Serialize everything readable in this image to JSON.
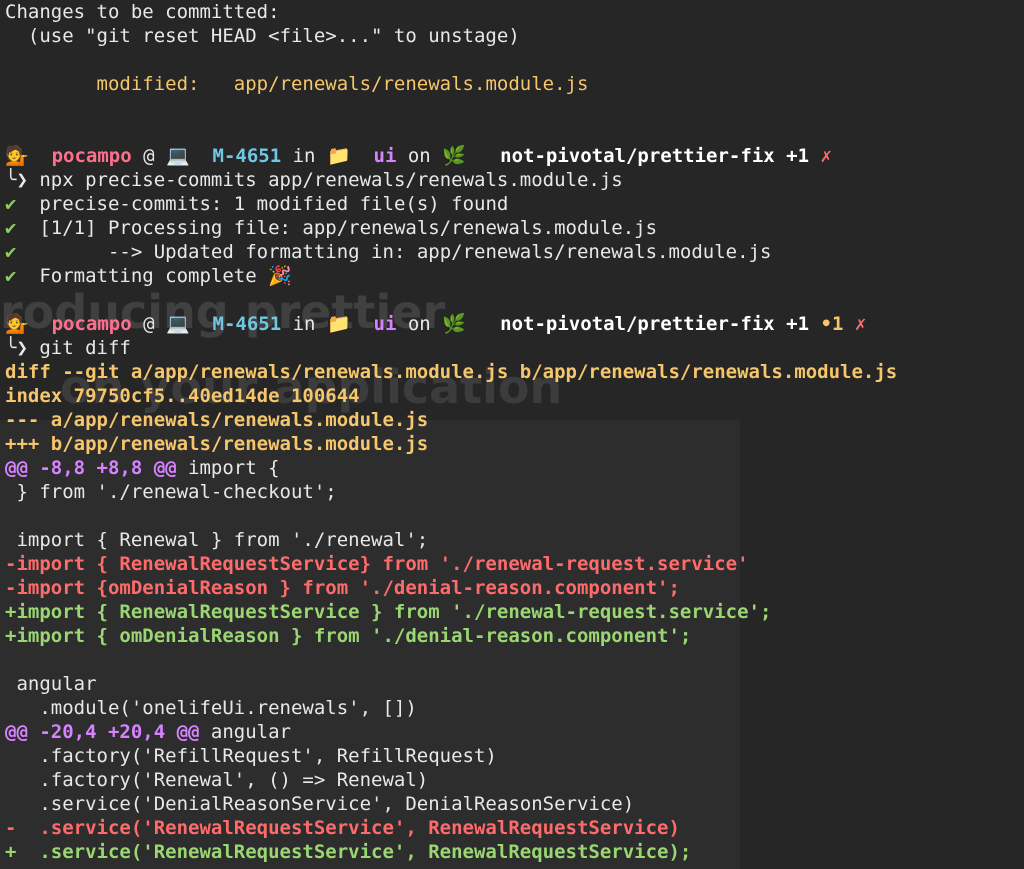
{
  "status": {
    "header": "Changes to be committed:",
    "hint": "  (use \"git reset HEAD <file>...\" to unstage)",
    "modified_label": "        modified:   ",
    "modified_file": "app/renewals/renewals.module.js"
  },
  "prompt1": {
    "user_icon": "💁",
    "user": "pocampo",
    "at": " @ ",
    "host_icon": "💻",
    "host": "M-4651",
    "in": " in ",
    "dir_icon": "📁",
    "dir": "ui",
    "on": " on ",
    "branch_icon": "🌿",
    "branch": "not-pivotal/prettier-fix",
    "ahead": "+1",
    "dirty": "✗"
  },
  "cmd1": {
    "arrow": "╰❯",
    "text": " npx precise-commits app/renewals/renewals.module.js"
  },
  "output": [
    {
      "mark": "✔",
      "text": "  precise-commits: 1 modified file(s) found"
    },
    {
      "mark": "✔",
      "text": "  [1/1] Processing file: app/renewals/renewals.module.js"
    },
    {
      "mark": "✔",
      "text": "        --> Updated formatting in: app/renewals/renewals.module.js"
    },
    {
      "mark": "✔",
      "text": "  Formatting complete 🎉"
    }
  ],
  "prompt2": {
    "user_icon": "💁",
    "user": "pocampo",
    "at": " @ ",
    "host_icon": "💻",
    "host": "M-4651",
    "in": " in ",
    "dir_icon": "📁",
    "dir": "ui",
    "on": " on ",
    "branch_icon": "🌿",
    "branch": "not-pivotal/prettier-fix",
    "ahead": "+1",
    "modified": "•1",
    "dirty": "✗"
  },
  "cmd2": {
    "arrow": "╰❯",
    "text": " git diff"
  },
  "diff": {
    "header": [
      "diff --git a/app/renewals/renewals.module.js b/app/renewals/renewals.module.js",
      "index 79750cf5..40ed14de 100644",
      "--- a/app/renewals/renewals.module.js",
      "+++ b/app/renewals/renewals.module.js"
    ],
    "hunk1": {
      "range": "@@ -8,8 +8,8 @@",
      "ctx": " import {"
    },
    "lines1": [
      {
        "type": "ctx",
        "text": " } from './renewal-checkout';"
      },
      {
        "type": "ctx",
        "text": " "
      },
      {
        "type": "ctx",
        "text": " import { Renewal } from './renewal';"
      },
      {
        "type": "del",
        "text": "-import { RenewalRequestService} from './renewal-request.service'"
      },
      {
        "type": "del",
        "text": "-import {omDenialReason } from './denial-reason.component';"
      },
      {
        "type": "add",
        "text": "+import { RenewalRequestService } from './renewal-request.service';"
      },
      {
        "type": "add",
        "text": "+import { omDenialReason } from './denial-reason.component';"
      },
      {
        "type": "ctx",
        "text": " "
      },
      {
        "type": "ctx",
        "text": " angular"
      },
      {
        "type": "ctx",
        "text": "   .module('onelifeUi.renewals', [])"
      }
    ],
    "hunk2": {
      "range": "@@ -20,4 +20,4 @@",
      "ctx": " angular"
    },
    "lines2": [
      {
        "type": "ctx",
        "text": "   .factory('RefillRequest', RefillRequest)"
      },
      {
        "type": "ctx",
        "text": "   .factory('Renewal', () => Renewal)"
      },
      {
        "type": "ctx",
        "text": "   .service('DenialReasonService', DenialReasonService)"
      },
      {
        "type": "del",
        "text": "-  .service('RenewalRequestService', RenewalRequestService)"
      },
      {
        "type": "add",
        "text": "+  .service('RenewalRequestService', RenewalRequestService);"
      }
    ]
  },
  "overlay": {
    "ghost_a": "roducing prettier",
    "ghost_b": "on your application"
  }
}
